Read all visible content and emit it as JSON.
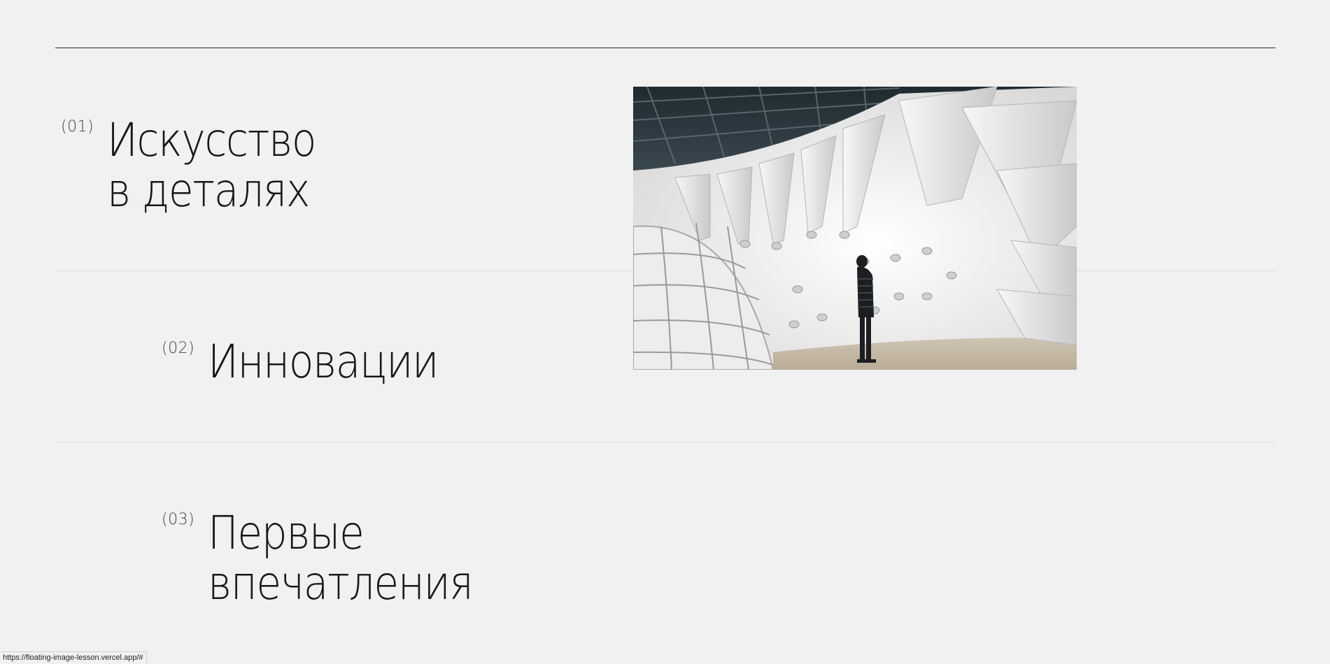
{
  "items": [
    {
      "number": "(01)",
      "title_line1": "Искусство",
      "title_line2": "в деталях"
    },
    {
      "number": "(02)",
      "title_line1": "Инновации",
      "title_line2": ""
    },
    {
      "number": "(03)",
      "title_line1": "Первые",
      "title_line2": "впечатления"
    }
  ],
  "floating_image": {
    "alt": "white paper pavilion installation with a person looking up"
  },
  "status_bar": {
    "url": "https://floating-image-lesson.vercel.app/#"
  },
  "colors": {
    "background": "#f1f1f1",
    "text": "#171717",
    "divider": "#dcdcdc"
  }
}
